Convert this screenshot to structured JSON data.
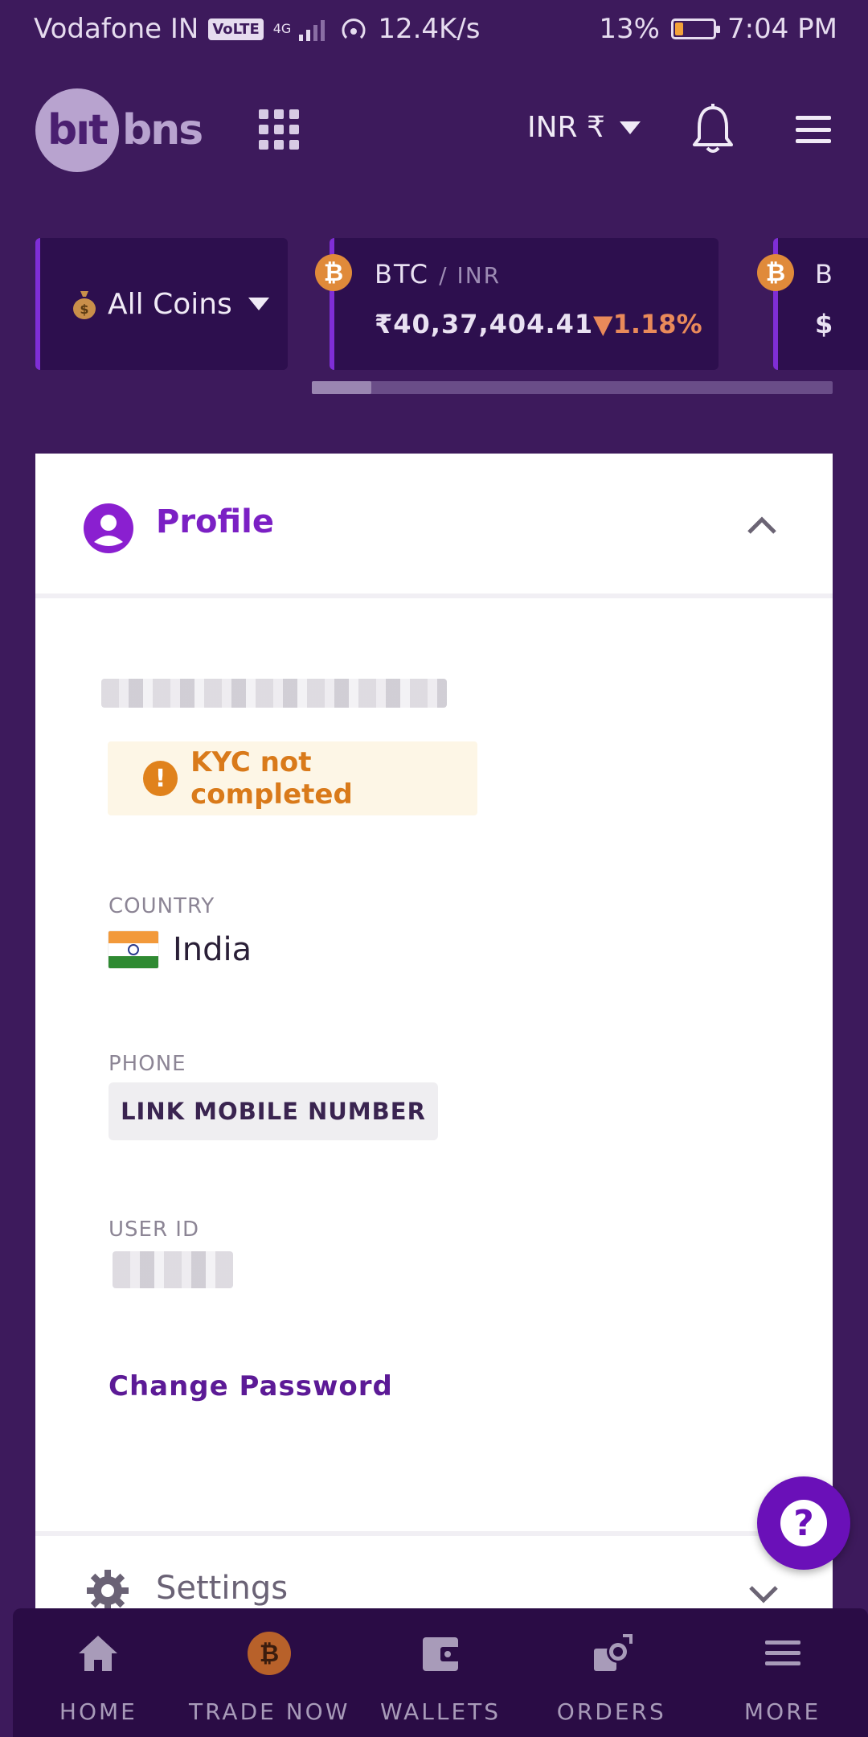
{
  "status_bar": {
    "carrier": "Vodafone IN",
    "volte": "VoLTE",
    "network": "4G",
    "speed": "12.4K/s",
    "battery": "13%",
    "time": "7:04 PM"
  },
  "header": {
    "logo_left": "bıt",
    "logo_right": "bns",
    "currency": "INR ₹",
    "icons": [
      "apps-grid-icon",
      "bell-icon",
      "hamburger-menu-icon"
    ]
  },
  "ticker": {
    "filter_label": "All Coins",
    "cards": [
      {
        "base": "BTC",
        "quote": "/ INR",
        "price": "₹40,37,404.41",
        "change": "▼1.18%"
      },
      {
        "base": "B",
        "price": "$"
      }
    ]
  },
  "profile": {
    "title": "Profile",
    "kyc_status": "KYC not completed",
    "country_label": "COUNTRY",
    "country": "India",
    "phone_label": "PHONE",
    "link_mobile": "LINK MOBILE NUMBER",
    "user_id_label": "USER ID",
    "change_password": "Change Password"
  },
  "settings": {
    "title": "Settings"
  },
  "bottom_nav": {
    "items": [
      {
        "label": "HOME",
        "icon": "home-icon"
      },
      {
        "label": "TRADE NOW",
        "icon": "bitcoin-icon"
      },
      {
        "label": "WALLETS",
        "icon": "wallet-icon"
      },
      {
        "label": "ORDERS",
        "icon": "orders-icon"
      },
      {
        "label": "MORE",
        "icon": "menu-icon"
      }
    ]
  },
  "colors": {
    "background": "#3d1a5c",
    "accent": "#7b20c4",
    "warning": "#d97a1a",
    "down": "#e98a5a"
  }
}
